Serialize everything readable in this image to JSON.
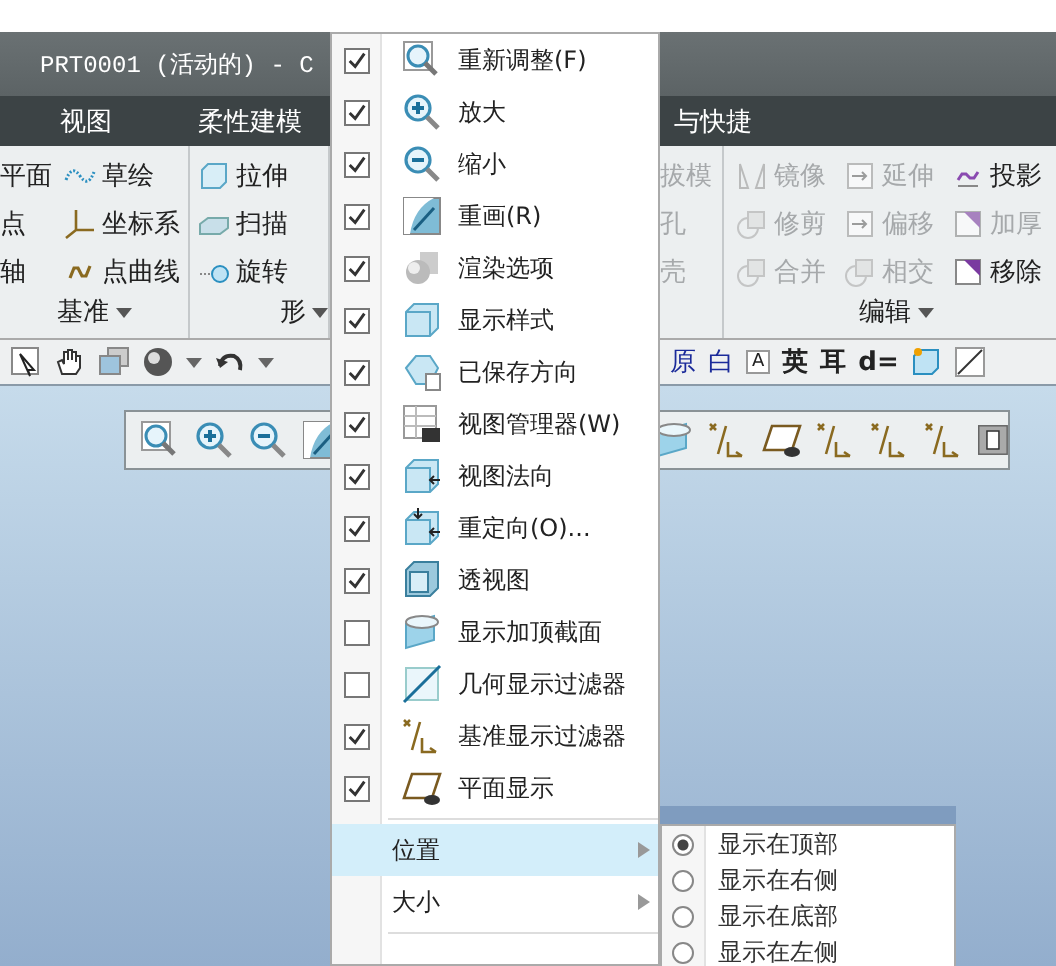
{
  "window": {
    "title": "PRT0001 (活动的) - C"
  },
  "tabs": [
    {
      "label": "视图"
    },
    {
      "label": "柔性建模"
    },
    {
      "label": "与快捷"
    }
  ],
  "ribbon": {
    "groups": [
      {
        "label": "基准",
        "columns": [
          [
            {
              "label": "平面",
              "disabled": false
            },
            {
              "label": "点",
              "disabled": false
            },
            {
              "label": "轴",
              "disabled": false
            }
          ],
          [
            {
              "label": "草绘",
              "disabled": false
            },
            {
              "label": "坐标系",
              "disabled": false
            },
            {
              "label": "点曲线",
              "disabled": false
            }
          ]
        ]
      },
      {
        "label": "形",
        "columns": [
          [
            {
              "label": "拉伸",
              "disabled": false
            },
            {
              "label": "扫描",
              "disabled": false
            },
            {
              "label": "旋转",
              "disabled": false
            }
          ]
        ]
      },
      {
        "columns": [
          [
            {
              "label": "拔模",
              "disabled": true
            },
            {
              "label": "孔",
              "disabled": true
            },
            {
              "label": "壳",
              "disabled": true
            }
          ]
        ]
      },
      {
        "label": "编辑",
        "columns": [
          [
            {
              "label": "镜像",
              "disabled": true
            },
            {
              "label": "修剪",
              "disabled": true
            },
            {
              "label": "合并",
              "disabled": true
            }
          ],
          [
            {
              "label": "延伸",
              "disabled": true
            },
            {
              "label": "偏移",
              "disabled": true
            },
            {
              "label": "相交",
              "disabled": true
            }
          ],
          [
            {
              "label": "投影",
              "disabled": false
            },
            {
              "label": "加厚",
              "disabled": true
            },
            {
              "label": "移除",
              "disabled": false
            }
          ]
        ]
      }
    ]
  },
  "toolbar": {
    "glyphs": [
      "原",
      "白",
      "A",
      "英",
      "耳",
      "d="
    ]
  },
  "menu": {
    "items": [
      {
        "label": "重新调整(F)",
        "checked": true
      },
      {
        "label": "放大",
        "checked": true
      },
      {
        "label": "缩小",
        "checked": true
      },
      {
        "label": "重画(R)",
        "checked": true
      },
      {
        "label": "渲染选项",
        "checked": true
      },
      {
        "label": "显示样式",
        "checked": true
      },
      {
        "label": "已保存方向",
        "checked": true
      },
      {
        "label": "视图管理器(W)",
        "checked": true
      },
      {
        "label": "视图法向",
        "checked": true
      },
      {
        "label": "重定向(O)...",
        "checked": true
      },
      {
        "label": "透视图",
        "checked": true
      },
      {
        "label": "显示加顶截面",
        "checked": false
      },
      {
        "label": "几何显示过滤器",
        "checked": false
      },
      {
        "label": "基准显示过滤器",
        "checked": true
      },
      {
        "label": "平面显示",
        "checked": true
      }
    ],
    "submenus": [
      {
        "label": "位置",
        "selected": true
      },
      {
        "label": "大小",
        "selected": false
      }
    ]
  },
  "position_submenu": {
    "options": [
      {
        "label": "显示在顶部",
        "selected": true
      },
      {
        "label": "显示在右侧",
        "selected": false
      },
      {
        "label": "显示在底部",
        "selected": false
      },
      {
        "label": "显示在左侧",
        "selected": false
      }
    ]
  }
}
